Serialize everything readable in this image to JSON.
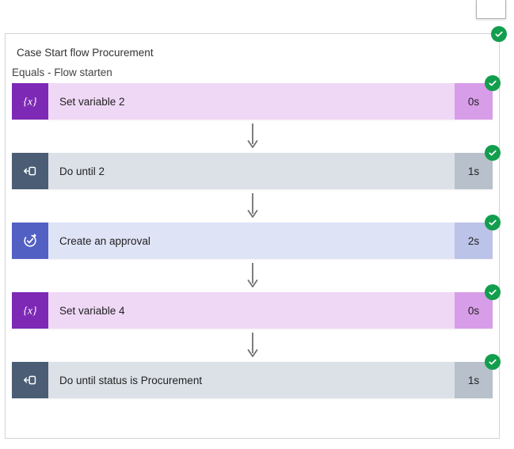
{
  "case_title": "Case Start flow Procurement",
  "case_subtitle": "Equals - Flow starten",
  "status_badge": "success-check-icon",
  "steps": [
    {
      "label": "Set variable 2",
      "duration": "0s",
      "theme": "purple",
      "icon": "variable-icon",
      "status": "success"
    },
    {
      "label": "Do until 2",
      "duration": "1s",
      "theme": "slate",
      "icon": "loop-arrow-icon",
      "status": "success"
    },
    {
      "label": "Create an approval",
      "duration": "2s",
      "theme": "indigo",
      "icon": "approval-check-icon",
      "status": "success"
    },
    {
      "label": "Set variable 4",
      "duration": "0s",
      "theme": "purple",
      "icon": "variable-icon",
      "status": "success"
    },
    {
      "label": "Do until status is Procurement",
      "duration": "1s",
      "theme": "slate",
      "icon": "loop-arrow-icon",
      "status": "success"
    }
  ]
}
